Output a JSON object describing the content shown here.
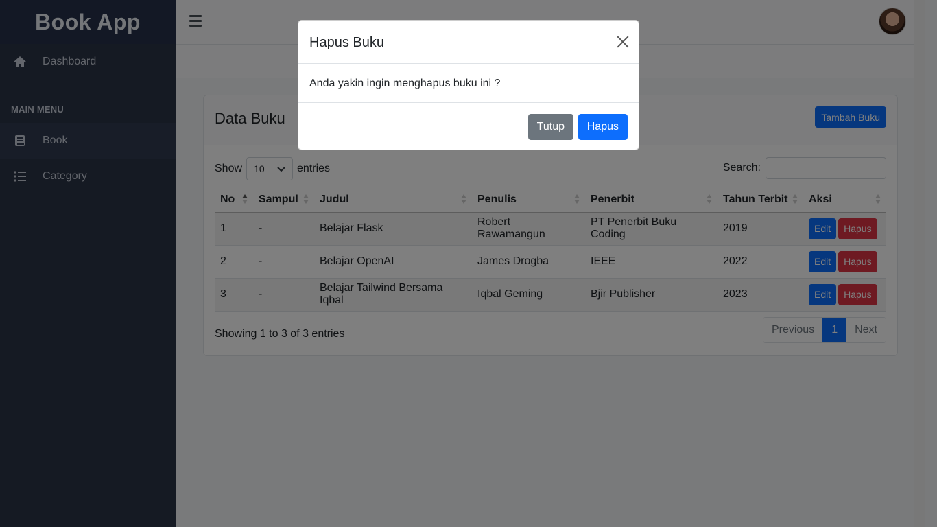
{
  "app": {
    "title": "Book App"
  },
  "sidebar": {
    "dashboard_label": "Dashboard",
    "section_label": "MAIN MENU",
    "items": [
      {
        "label": "Book",
        "icon": "book-icon"
      },
      {
        "label": "Category",
        "icon": "list-icon"
      }
    ]
  },
  "card": {
    "title": "Data Buku",
    "add_button": "Tambah Buku",
    "show_label": "Show",
    "page_length": "10",
    "entries_label": "entries",
    "search_label": "Search:",
    "columns": [
      "No",
      "Sampul",
      "Judul",
      "Penulis",
      "Penerbit",
      "Tahun Terbit",
      "Aksi"
    ],
    "rows": [
      {
        "no": "1",
        "sampul": "-",
        "judul": "Belajar Flask",
        "penulis": "Robert Rawamangun",
        "penerbit": "PT Penerbit Buku Coding",
        "tahun": "2019"
      },
      {
        "no": "2",
        "sampul": "-",
        "judul": "Belajar OpenAI",
        "penulis": "James Drogba",
        "penerbit": "IEEE",
        "tahun": "2022"
      },
      {
        "no": "3",
        "sampul": "-",
        "judul": "Belajar Tailwind Bersama Iqbal",
        "penulis": "Iqbal Geming",
        "penerbit": "Bjir Publisher",
        "tahun": "2023"
      }
    ],
    "edit_label": "Edit",
    "delete_label": "Hapus",
    "info": "Showing 1 to 3 of 3 entries",
    "pagination": {
      "previous": "Previous",
      "current": "1",
      "next": "Next"
    }
  },
  "modal": {
    "title": "Hapus Buku",
    "message": "Anda yakin ingin menghapus buku ini ?",
    "close_button": "Tutup",
    "confirm_button": "Hapus"
  },
  "colors": {
    "primary": "#0d6efd",
    "danger": "#dc3545",
    "secondary": "#6c757d",
    "sidebar": "#2b3446"
  }
}
